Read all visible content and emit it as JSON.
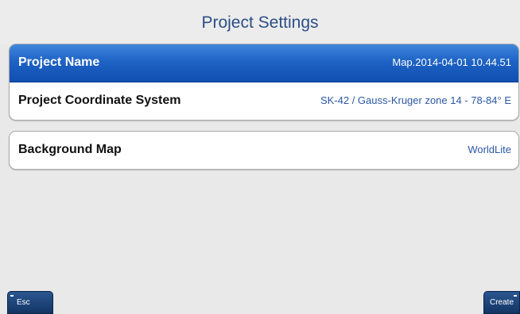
{
  "header": {
    "title": "Project Settings"
  },
  "settings": {
    "rows": [
      {
        "label": "Project Name",
        "value": "Map.2014-04-01 10.44.51",
        "selected": true
      },
      {
        "label": "Project Coordinate System",
        "value": "SK-42 / Gauss-Kruger zone 14 - 78-84° E",
        "selected": false
      },
      {
        "label": "Background Map",
        "value": "WorldLite",
        "selected": false
      }
    ]
  },
  "footer": {
    "esc_label": "Esc",
    "create_label": "Create"
  },
  "colors": {
    "accent": "#1f63c5",
    "title": "#2c4d86",
    "value_text": "#2b58a5",
    "background": "#e9e9e9"
  }
}
